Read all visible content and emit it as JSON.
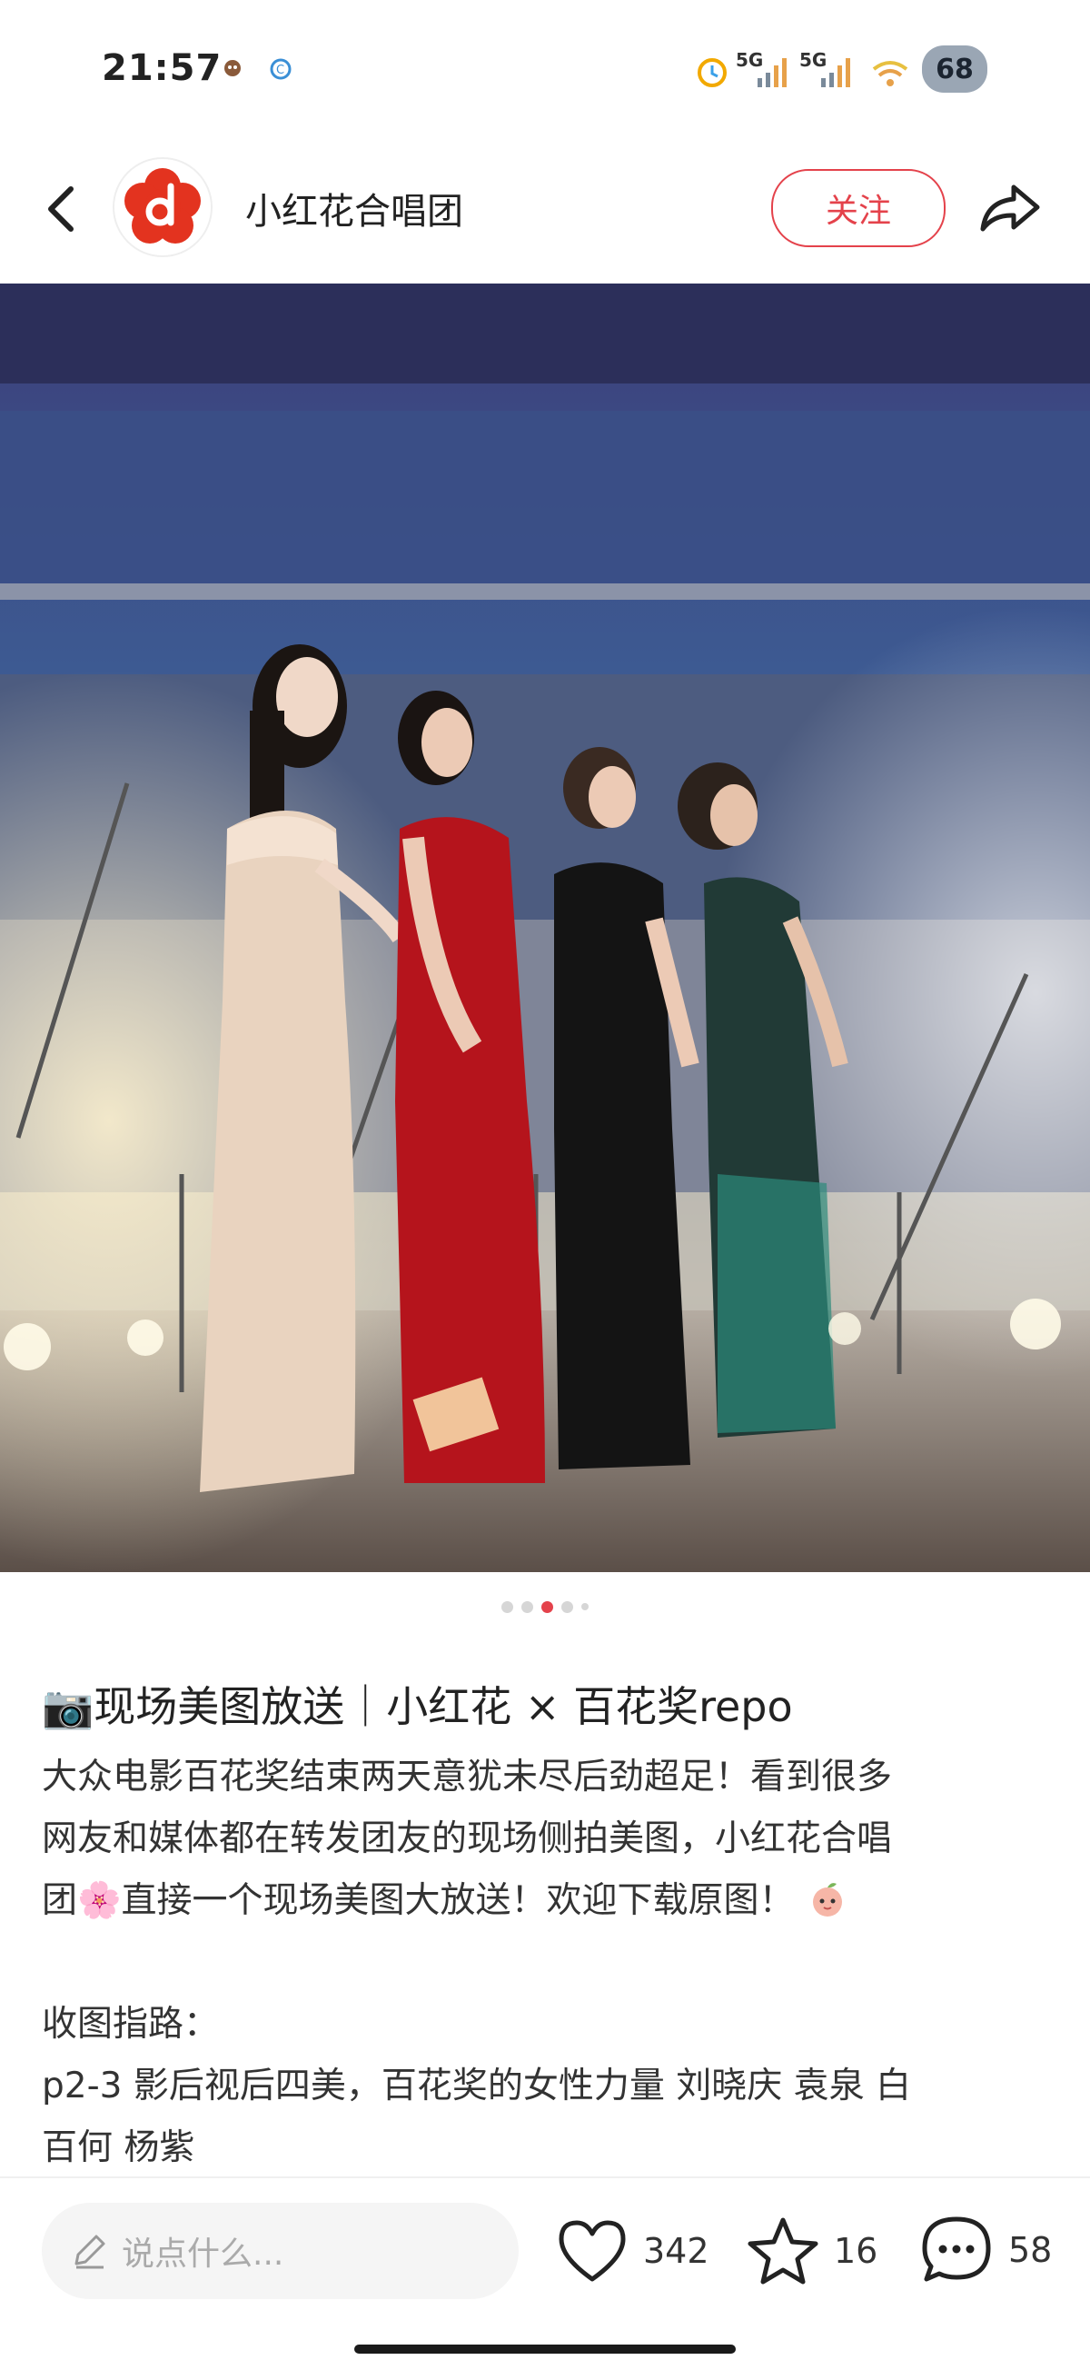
{
  "status_bar": {
    "time": "21:57",
    "network_1": "5G",
    "network_2": "5G",
    "battery": "68"
  },
  "header": {
    "account_name": "小红花合唱团",
    "follow_label": "关注"
  },
  "gallery": {
    "page_count": 5,
    "current_page": 3
  },
  "post": {
    "title": "📷现场美图放送｜小红花 × 百花奖repo",
    "body_line_1": "大众电影百花奖结束两天意犹未尽后劲超足！看到很多",
    "body_line_2": "网友和媒体都在转发团友的现场侧拍美图，小红花合唱",
    "body_line_3": "团🌸直接一个现场美图大放送！欢迎下载原图！",
    "guide_title": "收图指路：",
    "guide_line_1": "p2-3 影后视后四美，百花奖的女性力量 刘晓庆 袁泉 白",
    "guide_line_2": "百何 杨紫"
  },
  "bottom_bar": {
    "comment_placeholder": "说点什么...",
    "likes": "342",
    "favorites": "16",
    "comments": "58"
  },
  "colors": {
    "accent": "#e4424b",
    "text": "#222222"
  }
}
